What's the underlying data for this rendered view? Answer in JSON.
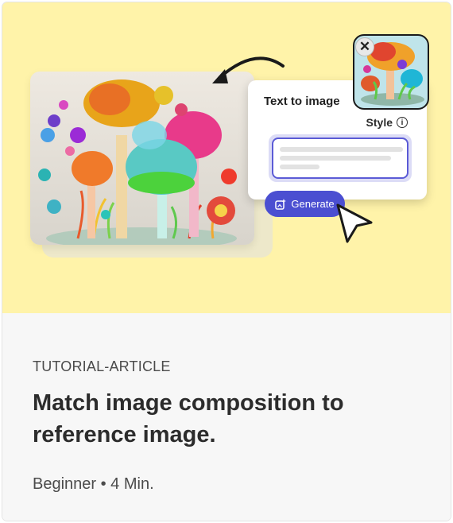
{
  "card": {
    "tag": "TUTORIAL-ARTICLE",
    "title": "Match image composition to reference image.",
    "meta": "Beginner • 4 Min."
  },
  "illustration": {
    "panel_title": "Text to image",
    "style_label": "Style",
    "generate_label": "Generate",
    "icons": [
      "arrow-icon",
      "info-icon",
      "generate-icon",
      "cursor-icon",
      "close-icon"
    ],
    "colors": {
      "hero_background": "#fff3a9",
      "generate_button": "#4b4fd1",
      "prompt_border": "#5b5bd6"
    }
  }
}
